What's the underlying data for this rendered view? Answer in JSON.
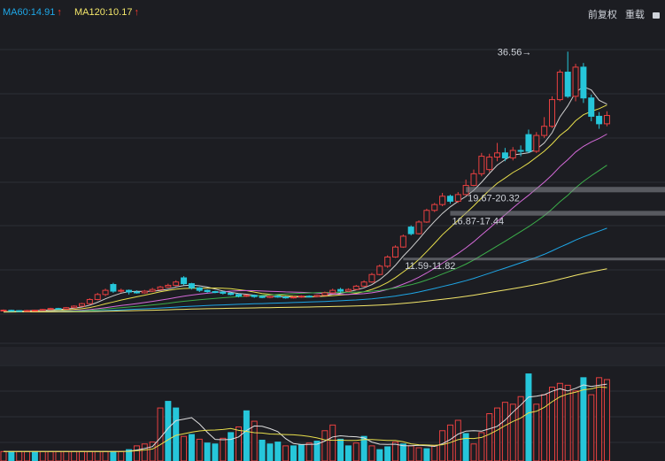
{
  "header": {
    "ma60": {
      "text": "MA60:14.91",
      "color": "#1ea6e6"
    },
    "ma120": {
      "text": "MA120:10.17",
      "color": "#f3e66a"
    },
    "up_arrow": "↑",
    "restore_label": "前复权",
    "reload_label": "重载"
  },
  "chart_data": {
    "type": "candlestick",
    "grid": true,
    "annotations": [
      {
        "text": "36.56→",
        "x_index": 68,
        "y": 36.56
      },
      {
        "text": "19.67-20.32",
        "price_low": 19.67,
        "price_high": 20.32,
        "from_index": 59
      },
      {
        "text": "16.87-17.44",
        "price_low": 16.87,
        "price_high": 17.44,
        "from_index": 57
      },
      {
        "text": "11.59-11.82",
        "price_low": 11.59,
        "price_high": 11.82,
        "from_index": 51
      }
    ],
    "price_range": [
      4.3,
      40.0
    ],
    "candles": [
      {
        "o": 5.45,
        "c": 5.52,
        "h": 5.6,
        "l": 5.4
      },
      {
        "o": 5.5,
        "c": 5.46,
        "h": 5.58,
        "l": 5.4
      },
      {
        "o": 5.46,
        "c": 5.42,
        "h": 5.52,
        "l": 5.35
      },
      {
        "o": 5.42,
        "c": 5.48,
        "h": 5.55,
        "l": 5.38
      },
      {
        "o": 5.48,
        "c": 5.52,
        "h": 5.58,
        "l": 5.44
      },
      {
        "o": 5.52,
        "c": 5.6,
        "h": 5.66,
        "l": 5.48
      },
      {
        "o": 5.6,
        "c": 5.72,
        "h": 5.8,
        "l": 5.55
      },
      {
        "o": 5.72,
        "c": 5.65,
        "h": 5.8,
        "l": 5.6
      },
      {
        "o": 5.65,
        "c": 5.82,
        "h": 5.9,
        "l": 5.6
      },
      {
        "o": 5.82,
        "c": 6.0,
        "h": 6.1,
        "l": 5.78
      },
      {
        "o": 6.0,
        "c": 6.3,
        "h": 6.4,
        "l": 5.95
      },
      {
        "o": 6.3,
        "c": 6.8,
        "h": 6.95,
        "l": 6.2
      },
      {
        "o": 6.8,
        "c": 7.4,
        "h": 7.6,
        "l": 6.7
      },
      {
        "o": 7.4,
        "c": 7.9,
        "h": 8.1,
        "l": 7.2
      },
      {
        "o": 8.6,
        "c": 7.8,
        "h": 8.8,
        "l": 7.6
      },
      {
        "o": 7.8,
        "c": 7.9,
        "h": 8.1,
        "l": 7.6
      },
      {
        "o": 7.9,
        "c": 7.7,
        "h": 8.0,
        "l": 7.4
      },
      {
        "o": 7.7,
        "c": 7.6,
        "h": 7.9,
        "l": 7.5
      },
      {
        "o": 7.6,
        "c": 7.8,
        "h": 7.95,
        "l": 7.5
      },
      {
        "o": 7.8,
        "c": 8.0,
        "h": 8.2,
        "l": 7.7
      },
      {
        "o": 8.0,
        "c": 8.3,
        "h": 8.45,
        "l": 7.9
      },
      {
        "o": 8.3,
        "c": 8.5,
        "h": 8.7,
        "l": 8.2
      },
      {
        "o": 8.5,
        "c": 8.9,
        "h": 9.1,
        "l": 8.4
      },
      {
        "o": 9.4,
        "c": 8.7,
        "h": 9.6,
        "l": 8.5
      },
      {
        "o": 8.7,
        "c": 8.2,
        "h": 8.8,
        "l": 8.0
      },
      {
        "o": 8.2,
        "c": 7.9,
        "h": 8.3,
        "l": 7.7
      },
      {
        "o": 7.9,
        "c": 7.75,
        "h": 8.0,
        "l": 7.6
      },
      {
        "o": 7.75,
        "c": 7.7,
        "h": 7.85,
        "l": 7.55
      },
      {
        "o": 7.7,
        "c": 7.55,
        "h": 7.8,
        "l": 7.4
      },
      {
        "o": 7.55,
        "c": 7.4,
        "h": 7.65,
        "l": 7.3
      },
      {
        "o": 7.4,
        "c": 7.2,
        "h": 7.5,
        "l": 7.05
      },
      {
        "o": 7.2,
        "c": 7.3,
        "h": 7.4,
        "l": 7.1
      },
      {
        "o": 7.3,
        "c": 7.15,
        "h": 7.4,
        "l": 7.0
      },
      {
        "o": 7.15,
        "c": 7.05,
        "h": 7.25,
        "l": 6.95
      },
      {
        "o": 7.05,
        "c": 7.2,
        "h": 7.3,
        "l": 6.95
      },
      {
        "o": 7.2,
        "c": 7.1,
        "h": 7.35,
        "l": 7.0
      },
      {
        "o": 7.1,
        "c": 7.0,
        "h": 7.2,
        "l": 6.9
      },
      {
        "o": 7.0,
        "c": 7.1,
        "h": 7.2,
        "l": 6.92
      },
      {
        "o": 7.1,
        "c": 7.2,
        "h": 7.3,
        "l": 7.0
      },
      {
        "o": 7.2,
        "c": 7.15,
        "h": 7.3,
        "l": 7.05
      },
      {
        "o": 7.15,
        "c": 7.3,
        "h": 7.4,
        "l": 7.1
      },
      {
        "o": 7.3,
        "c": 7.6,
        "h": 7.75,
        "l": 7.25
      },
      {
        "o": 7.6,
        "c": 7.9,
        "h": 8.1,
        "l": 7.5
      },
      {
        "o": 8.0,
        "c": 7.8,
        "h": 8.2,
        "l": 7.6
      },
      {
        "o": 7.8,
        "c": 8.0,
        "h": 8.15,
        "l": 7.7
      },
      {
        "o": 8.0,
        "c": 8.4,
        "h": 8.55,
        "l": 7.95
      },
      {
        "o": 8.4,
        "c": 8.9,
        "h": 9.1,
        "l": 8.3
      },
      {
        "o": 8.9,
        "c": 9.8,
        "h": 10.0,
        "l": 8.8
      },
      {
        "o": 9.8,
        "c": 10.8,
        "h": 11.0,
        "l": 9.7
      },
      {
        "o": 10.8,
        "c": 11.9,
        "h": 12.1,
        "l": 10.6
      },
      {
        "o": 11.9,
        "c": 13.1,
        "h": 13.3,
        "l": 11.8
      },
      {
        "o": 13.1,
        "c": 14.4,
        "h": 14.6,
        "l": 13.0
      },
      {
        "o": 15.5,
        "c": 14.7,
        "h": 15.7,
        "l": 14.5
      },
      {
        "o": 14.7,
        "c": 16.1,
        "h": 16.3,
        "l": 14.6
      },
      {
        "o": 16.1,
        "c": 17.5,
        "h": 17.7,
        "l": 16.0
      },
      {
        "o": 17.5,
        "c": 18.2,
        "h": 18.4,
        "l": 17.3
      },
      {
        "o": 18.2,
        "c": 19.2,
        "h": 19.6,
        "l": 18.0
      },
      {
        "o": 19.2,
        "c": 18.6,
        "h": 19.4,
        "l": 18.3
      },
      {
        "o": 18.6,
        "c": 19.4,
        "h": 19.7,
        "l": 18.4
      },
      {
        "o": 19.4,
        "c": 20.5,
        "h": 21.2,
        "l": 19.3
      },
      {
        "o": 20.5,
        "c": 21.9,
        "h": 22.4,
        "l": 20.4
      },
      {
        "o": 21.9,
        "c": 24.0,
        "h": 24.4,
        "l": 21.6
      },
      {
        "o": 22.4,
        "c": 23.9,
        "h": 24.3,
        "l": 22.1
      },
      {
        "o": 23.9,
        "c": 24.4,
        "h": 25.6,
        "l": 23.4
      },
      {
        "o": 24.4,
        "c": 23.8,
        "h": 25.0,
        "l": 23.4
      },
      {
        "o": 23.8,
        "c": 24.7,
        "h": 25.1,
        "l": 23.5
      },
      {
        "o": 24.7,
        "c": 24.6,
        "h": 25.3,
        "l": 24.0
      },
      {
        "o": 26.6,
        "c": 24.6,
        "h": 27.2,
        "l": 24.4
      },
      {
        "o": 24.6,
        "c": 26.5,
        "h": 26.9,
        "l": 24.4
      },
      {
        "o": 26.5,
        "c": 27.6,
        "h": 28.7,
        "l": 26.2
      },
      {
        "o": 27.6,
        "c": 30.8,
        "h": 31.2,
        "l": 27.4
      },
      {
        "o": 30.8,
        "c": 34.1,
        "h": 34.4,
        "l": 30.6
      },
      {
        "o": 34.1,
        "c": 31.2,
        "h": 36.56,
        "l": 31.0
      },
      {
        "o": 31.2,
        "c": 34.7,
        "h": 35.1,
        "l": 30.6
      },
      {
        "o": 34.7,
        "c": 31.0,
        "h": 35.2,
        "l": 30.4
      },
      {
        "o": 31.0,
        "c": 28.8,
        "h": 31.4,
        "l": 28.2
      },
      {
        "o": 28.8,
        "c": 27.9,
        "h": 29.3,
        "l": 27.3
      },
      {
        "o": 27.9,
        "c": 28.9,
        "h": 29.4,
        "l": 27.6
      }
    ],
    "volume": [
      {
        "v": 1.0,
        "up": true
      },
      {
        "v": 1.0,
        "up": false
      },
      {
        "v": 1.0,
        "up": true
      },
      {
        "v": 1.0,
        "up": true
      },
      {
        "v": 1.0,
        "up": false
      },
      {
        "v": 1.0,
        "up": true
      },
      {
        "v": 1.0,
        "up": true
      },
      {
        "v": 1.0,
        "up": true
      },
      {
        "v": 1.0,
        "up": true
      },
      {
        "v": 1.0,
        "up": true
      },
      {
        "v": 1.0,
        "up": true
      },
      {
        "v": 1.0,
        "up": true
      },
      {
        "v": 1.0,
        "up": true
      },
      {
        "v": 1.0,
        "up": true
      },
      {
        "v": 1.0,
        "up": false
      },
      {
        "v": 1.0,
        "up": true
      },
      {
        "v": 1.2,
        "up": false
      },
      {
        "v": 1.6,
        "up": true
      },
      {
        "v": 1.8,
        "up": true
      },
      {
        "v": 2.0,
        "up": true
      },
      {
        "v": 5.6,
        "up": true
      },
      {
        "v": 6.3,
        "up": false
      },
      {
        "v": 5.6,
        "up": false
      },
      {
        "v": 2.6,
        "up": true
      },
      {
        "v": 2.8,
        "up": false
      },
      {
        "v": 2.3,
        "up": true
      },
      {
        "v": 1.9,
        "up": false
      },
      {
        "v": 1.8,
        "up": false
      },
      {
        "v": 2.4,
        "up": true
      },
      {
        "v": 3.0,
        "up": false
      },
      {
        "v": 3.6,
        "up": true
      },
      {
        "v": 5.3,
        "up": false
      },
      {
        "v": 4.2,
        "up": true
      },
      {
        "v": 2.2,
        "up": false
      },
      {
        "v": 1.8,
        "up": false
      },
      {
        "v": 2.0,
        "up": false
      },
      {
        "v": 1.6,
        "up": true
      },
      {
        "v": 1.6,
        "up": false
      },
      {
        "v": 1.7,
        "up": false
      },
      {
        "v": 1.9,
        "up": true
      },
      {
        "v": 2.1,
        "up": false
      },
      {
        "v": 3.2,
        "up": true
      },
      {
        "v": 3.8,
        "up": true
      },
      {
        "v": 2.3,
        "up": false
      },
      {
        "v": 1.6,
        "up": false
      },
      {
        "v": 1.9,
        "up": true
      },
      {
        "v": 2.6,
        "up": false
      },
      {
        "v": 1.6,
        "up": true
      },
      {
        "v": 1.2,
        "up": false
      },
      {
        "v": 1.5,
        "up": false
      },
      {
        "v": 2.0,
        "up": true
      },
      {
        "v": 1.8,
        "up": false
      },
      {
        "v": 1.6,
        "up": true
      },
      {
        "v": 1.4,
        "up": true
      },
      {
        "v": 1.3,
        "up": false
      },
      {
        "v": 1.6,
        "up": true
      },
      {
        "v": 3.2,
        "up": true
      },
      {
        "v": 3.8,
        "up": true
      },
      {
        "v": 4.3,
        "up": true
      },
      {
        "v": 2.9,
        "up": false
      },
      {
        "v": 1.8,
        "up": true
      },
      {
        "v": 3.0,
        "up": true
      },
      {
        "v": 5.0,
        "up": true
      },
      {
        "v": 5.6,
        "up": true
      },
      {
        "v": 6.2,
        "up": true
      },
      {
        "v": 6.0,
        "up": true
      },
      {
        "v": 6.8,
        "up": true
      },
      {
        "v": 9.2,
        "up": false
      },
      {
        "v": 6.0,
        "up": true
      },
      {
        "v": 7.0,
        "up": true
      },
      {
        "v": 7.8,
        "up": true
      },
      {
        "v": 8.2,
        "up": true
      },
      {
        "v": 8.0,
        "up": true
      },
      {
        "v": 7.4,
        "up": true
      },
      {
        "v": 8.8,
        "up": false
      },
      {
        "v": 7.0,
        "up": true
      },
      {
        "v": 8.8,
        "up": true
      },
      {
        "v": 8.6,
        "up": true
      },
      {
        "v": 9.0,
        "up": false
      },
      {
        "v": 8.8,
        "up": true
      },
      {
        "v": 7.6,
        "up": true
      },
      {
        "v": 8.8,
        "up": false
      },
      {
        "v": 8.2,
        "up": true
      },
      {
        "v": 8.0,
        "up": true
      },
      {
        "v": 9.0,
        "up": true
      },
      {
        "v": 8.6,
        "up": false
      },
      {
        "v": 8.8,
        "up": true
      }
    ],
    "moving_averages": [
      {
        "name": "MA5",
        "color": "#d0d0d0",
        "period": 5
      },
      {
        "name": "MA10",
        "color": "#e8df4c",
        "period": 10
      },
      {
        "name": "MA20",
        "color": "#d46ad8",
        "period": 20
      },
      {
        "name": "MA30",
        "color": "#3cae4a",
        "period": 30
      },
      {
        "name": "MA60",
        "color": "#1ea6e6",
        "period": 60
      },
      {
        "name": "MA120",
        "color": "#f3e66a",
        "period": 120
      }
    ],
    "volume_ma": [
      {
        "name": "VMA5",
        "color": "#e0e0e0",
        "period": 5
      },
      {
        "name": "VMA10",
        "color": "#e8df4c",
        "period": 10
      }
    ],
    "colors": {
      "up": "#e84040",
      "down": "#26c6da",
      "grid": "#2c2e36",
      "axis_text": "#cfd3da"
    }
  }
}
